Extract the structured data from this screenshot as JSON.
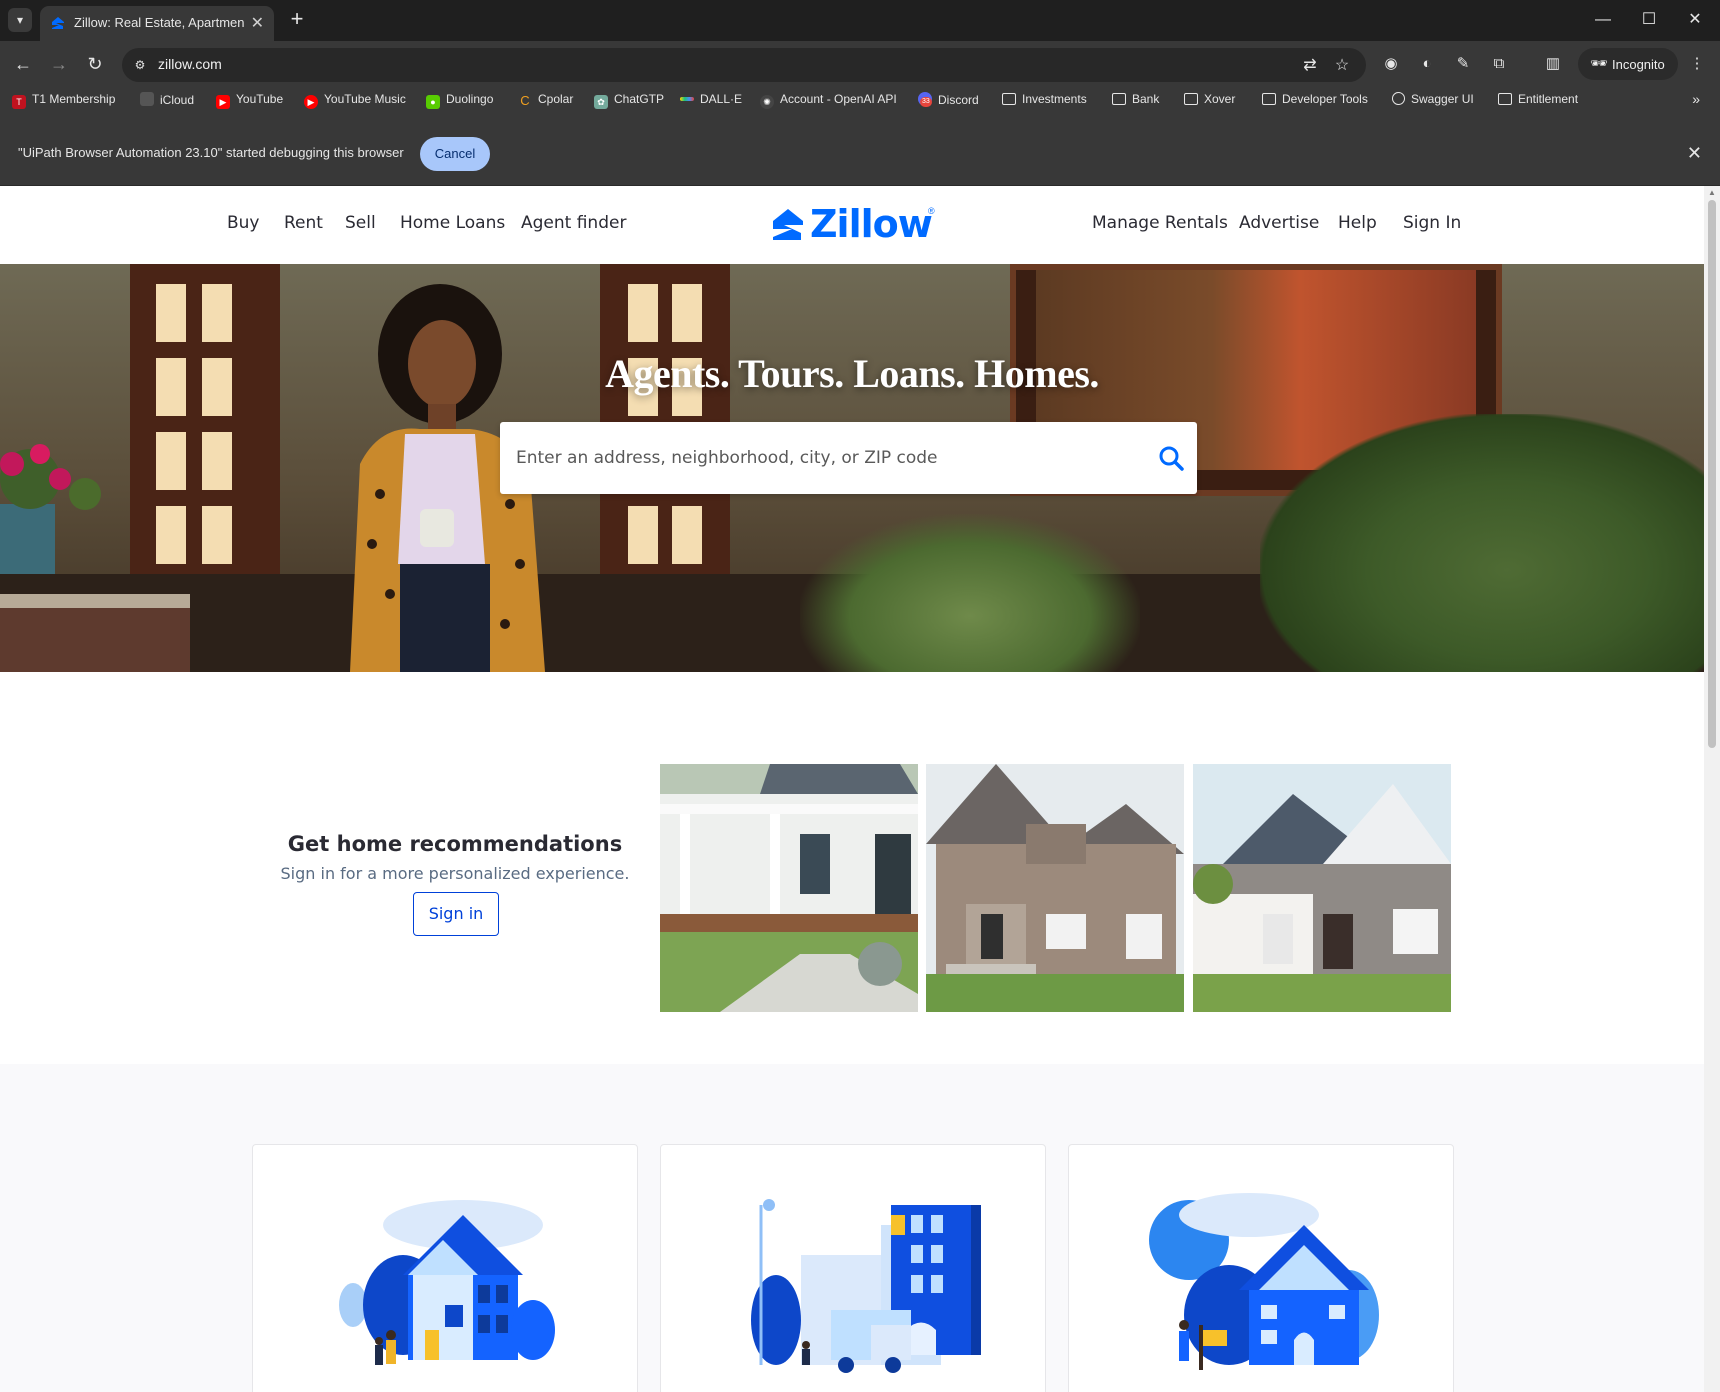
{
  "browser": {
    "tab_title": "Zillow: Real Estate, Apartments,",
    "url": "zillow.com",
    "incognito_label": "Incognito",
    "bookmarks": [
      {
        "label": "T1 Membership",
        "icon": "t1-icon",
        "color": "#c1121f"
      },
      {
        "label": "iCloud",
        "icon": "apple-icon",
        "color": "#555555"
      },
      {
        "label": "YouTube",
        "icon": "youtube-icon",
        "color": "#ff0000"
      },
      {
        "label": "YouTube Music",
        "icon": "youtube-music-icon",
        "color": "#ff0000"
      },
      {
        "label": "Duolingo",
        "icon": "duolingo-icon",
        "color": "#58cc02"
      },
      {
        "label": "Cpolar",
        "icon": "cpolar-icon",
        "color": "#f0a020"
      },
      {
        "label": "ChatGTP",
        "icon": "chatgpt-icon",
        "color": "#74aa9c"
      },
      {
        "label": "DALL·E",
        "icon": "dalle-icon",
        "color": "#888888"
      },
      {
        "label": "Account - OpenAI API",
        "icon": "openai-icon",
        "color": "#444444"
      },
      {
        "label": "Discord",
        "icon": "discord-icon",
        "color": "#5865f2"
      },
      {
        "label": "Investments",
        "icon": "folder-icon",
        "color": ""
      },
      {
        "label": "Bank",
        "icon": "folder-icon",
        "color": ""
      },
      {
        "label": "Xover",
        "icon": "folder-icon",
        "color": ""
      },
      {
        "label": "Developer Tools",
        "icon": "folder-icon",
        "color": ""
      },
      {
        "label": "Swagger UI",
        "icon": "globe-icon",
        "color": ""
      },
      {
        "label": "Entitlement",
        "icon": "folder-icon",
        "color": ""
      }
    ],
    "discord_badge": "33",
    "infobar": {
      "message": "\"UiPath Browser Automation 23.10\" started debugging this browser",
      "cancel_label": "Cancel"
    }
  },
  "page": {
    "nav_left": [
      "Buy",
      "Rent",
      "Sell",
      "Home Loans",
      "Agent finder"
    ],
    "nav_right": [
      "Manage Rentals",
      "Advertise",
      "Help",
      "Sign In"
    ],
    "logo_text": "Zillow",
    "logo_reg": "®",
    "hero_title": "Agents. Tours. Loans. Homes.",
    "search_placeholder": "Enter an address, neighborhood, city, or ZIP code",
    "recs": {
      "heading": "Get home recommendations",
      "subtext": "Sign in for a more personalized experience.",
      "signin_label": "Sign in"
    },
    "colors": {
      "brand": "#006aff",
      "link": "#0041d9"
    }
  }
}
